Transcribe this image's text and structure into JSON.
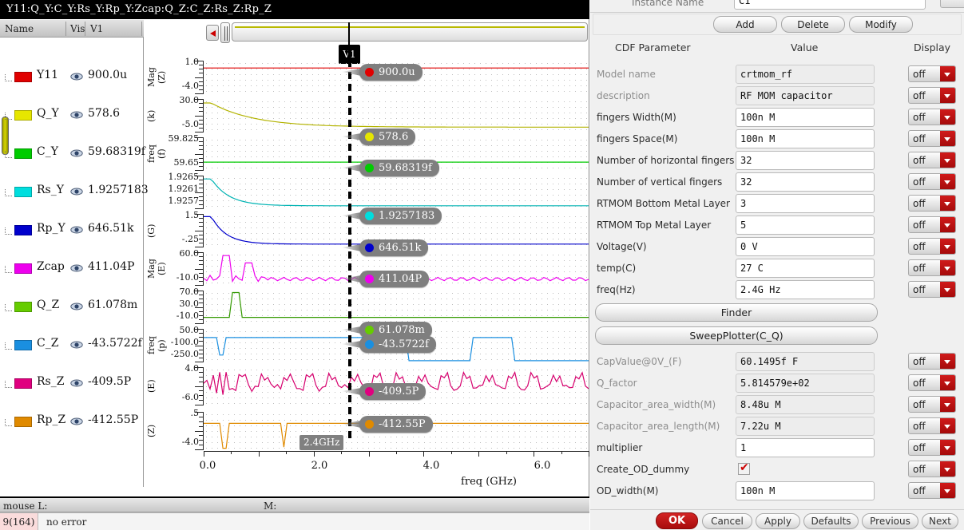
{
  "wave_window": {
    "title": "Y11:Q_Y:C_Y:Rs_Y:Rp_Y:Zcap:Q_Z:C_Z:Rs_Z:Rp_Z",
    "list_headers": {
      "name": "Name",
      "vis": "Vis",
      "v1": "V1"
    },
    "cursor_label": "V1",
    "cursor_freq_tag": "2.4GHz",
    "signals": [
      {
        "name": "Y11",
        "value": "900.0u",
        "color": "#e00000"
      },
      {
        "name": "Q_Y",
        "value": "578.6",
        "color": "#e6e600"
      },
      {
        "name": "C_Y",
        "value": "59.68319f",
        "color": "#00cc00"
      },
      {
        "name": "Rs_Y",
        "value": "1.9257183",
        "color": "#00dede"
      },
      {
        "name": "Rp_Y",
        "value": "646.51k",
        "color": "#0000cc"
      },
      {
        "name": "Zcap",
        "value": "411.04P",
        "color": "#ee00ee"
      },
      {
        "name": "Q_Z",
        "value": "61.078m",
        "color": "#66cc00"
      },
      {
        "name": "C_Z",
        "value": "-43.5722f",
        "color": "#1a8fe0"
      },
      {
        "name": "Rs_Z",
        "value": "-409.5P",
        "color": "#e0007f"
      },
      {
        "name": "Rp_Z",
        "value": "-412.55P",
        "color": "#e08a00"
      }
    ],
    "status": {
      "mouse_left": "mouse L:",
      "mouse_mid": "M:",
      "error_count": "9(164)",
      "error_text": "no error"
    }
  },
  "chart_data": {
    "type": "line",
    "title": "Y11:Q_Y:C_Y:Rs_Y:Rp_Y:Zcap:Q_Z:C_Z:Rs_Z:Rp_Z",
    "xlabel": "freq (GHz)",
    "xlim": [
      -0.2,
      7.0
    ],
    "xticks": [
      "0.0",
      "2.0",
      "4.0",
      "6.0"
    ],
    "cursor_x": "2.4GHz",
    "grid": true,
    "legend": "left-signal-list",
    "panels": [
      {
        "name": "Y11",
        "ylabel": "Mag (Z)",
        "yticks": [
          "1.0",
          "-4.0"
        ],
        "ylim": [
          -4.0,
          1.0
        ],
        "color": "#e00000",
        "marker_value": "900.0u"
      },
      {
        "name": "Q_Y",
        "ylabel": "(k)",
        "yticks": [
          "30.0",
          "-5.0"
        ],
        "ylim": [
          -5.0,
          30.0
        ],
        "color": "#b3b300",
        "marker_value": "578.6"
      },
      {
        "name": "C_Y",
        "ylabel": "freq (f)",
        "yticks": [
          "59.825",
          "59.65"
        ],
        "ylim": [
          59.65,
          59.825
        ],
        "color": "#00cc00",
        "marker_value": "59.68319f"
      },
      {
        "name": "Rs_Y",
        "ylabel": "",
        "yticks": [
          "1.9265",
          "1.9261",
          "1.9257"
        ],
        "ylim": [
          1.9257,
          1.9265
        ],
        "color": "#00b3b3",
        "marker_value": "1.9257183"
      },
      {
        "name": "Rp_Y",
        "ylabel": "(G)",
        "yticks": [
          "1.5",
          "-.25"
        ],
        "ylim": [
          -0.25,
          1.5
        ],
        "color": "#0000cc",
        "marker_value": "646.51k"
      },
      {
        "name": "Zcap",
        "ylabel": "Mag (E)",
        "yticks": [
          "60.0",
          "-10.0"
        ],
        "ylim": [
          -10.0,
          60.0
        ],
        "color": "#ee00ee",
        "marker_value": "411.04P"
      },
      {
        "name": "Q_Z",
        "ylabel": "",
        "yticks": [
          "70.0",
          "30.0",
          "-10.0"
        ],
        "ylim": [
          -10.0,
          70.0
        ],
        "color": "#339900",
        "marker_value": "61.078m"
      },
      {
        "name": "C_Z",
        "ylabel": "freq (p)",
        "yticks": [
          "50.0",
          "-100.0",
          "-250.0"
        ],
        "ylim": [
          -250.0,
          50.0
        ],
        "color": "#1a8fe0",
        "marker_value": "-43.5722f"
      },
      {
        "name": "Rs_Z",
        "ylabel": "(E)",
        "yticks": [
          "4.0",
          "-6.0"
        ],
        "ylim": [
          -6.0,
          4.0
        ],
        "color": "#d6006e",
        "marker_value": "-409.5P"
      },
      {
        "name": "Rp_Z",
        "ylabel": "(Z)",
        "yticks": [
          ".5",
          "-4.0"
        ],
        "ylim": [
          -4.0,
          0.5
        ],
        "color": "#e08a00",
        "marker_value": "-412.55P"
      }
    ]
  },
  "form": {
    "instance_name_label": "Instance Name",
    "instance_name_value": "C1",
    "buttons": {
      "add": "Add",
      "delete": "Delete",
      "modify": "Modify"
    },
    "headers": {
      "param": "CDF Parameter",
      "value": "Value",
      "display": "Display"
    },
    "display_default": "off",
    "wide_buttons": {
      "finder": "Finder",
      "sweep": "SweepPlotter(C_Q)"
    },
    "rows": [
      {
        "label": "Model name",
        "value": "crtmom_rf",
        "type": "text",
        "readonly": true,
        "display": "off"
      },
      {
        "label": "description",
        "value": " RF MOM capacitor",
        "type": "text",
        "readonly": true,
        "display": "off"
      },
      {
        "label": "fingers Width(M)",
        "value": "100n M",
        "type": "text",
        "readonly": false,
        "display": "off"
      },
      {
        "label": "fingers Space(M)",
        "value": "100n M",
        "type": "text",
        "readonly": false,
        "display": "off"
      },
      {
        "label": "Number of horizontal fingers",
        "value": "32",
        "type": "text",
        "readonly": false,
        "display": "off"
      },
      {
        "label": "Number of vertical fingers",
        "value": "32",
        "type": "text",
        "readonly": false,
        "display": "off"
      },
      {
        "label": "RTMOM Bottom Metal Layer",
        "value": "3",
        "type": "text",
        "readonly": false,
        "display": "off"
      },
      {
        "label": "RTMOM Top Metal Layer",
        "value": "5",
        "type": "text",
        "readonly": false,
        "display": "off"
      },
      {
        "label": "Voltage(V)",
        "value": "0 V",
        "type": "text",
        "readonly": false,
        "display": "off"
      },
      {
        "label": "temp(C)",
        "value": "27 C",
        "type": "text",
        "readonly": false,
        "display": "off"
      },
      {
        "label": "freq(Hz)",
        "value": "2.4G Hz",
        "type": "text",
        "readonly": false,
        "display": "off"
      }
    ],
    "rows2": [
      {
        "label": "CapValue@0V_(F)",
        "value": "60.1495f F",
        "type": "text",
        "readonly": true,
        "display": "off"
      },
      {
        "label": "Q_factor",
        "value": "5.814579e+02",
        "type": "text",
        "readonly": true,
        "display": "off"
      },
      {
        "label": "Capacitor_area_width(M)",
        "value": "8.48u M",
        "type": "text",
        "readonly": true,
        "display": "off"
      },
      {
        "label": "Capacitor_area_length(M)",
        "value": "7.22u M",
        "type": "text",
        "readonly": true,
        "display": "off"
      },
      {
        "label": "multiplier",
        "value": "1",
        "type": "text",
        "readonly": false,
        "display": "off"
      },
      {
        "label": "Create_OD_dummy",
        "value": "",
        "type": "checkbox",
        "checked": true,
        "display": "off"
      },
      {
        "label": "OD_width(M)",
        "value": "100n M",
        "type": "text",
        "readonly": false,
        "display": "off"
      }
    ],
    "footer": {
      "ok": "OK",
      "cancel": "Cancel",
      "apply": "Apply",
      "defaults": "Defaults",
      "previous": "Previous",
      "next": "Next"
    }
  }
}
